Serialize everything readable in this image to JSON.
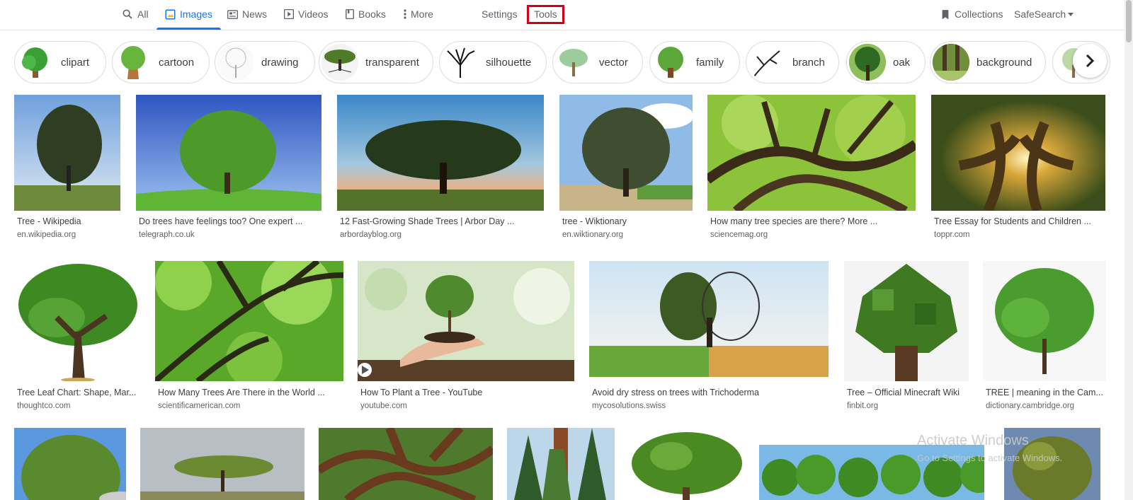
{
  "nav": {
    "all": "All",
    "images": "Images",
    "news": "News",
    "videos": "Videos",
    "books": "Books",
    "more": "More",
    "settings": "Settings",
    "tools": "Tools"
  },
  "right": {
    "collections": "Collections",
    "safesearch": "SafeSearch"
  },
  "chips": [
    "clipart",
    "cartoon",
    "drawing",
    "transparent",
    "silhouette",
    "vector",
    "family",
    "branch",
    "oak",
    "background"
  ],
  "results": [
    {
      "title": "Tree - Wikipedia",
      "source": "en.wikipedia.org"
    },
    {
      "title": "Do trees have feelings too? One expert ...",
      "source": "telegraph.co.uk"
    },
    {
      "title": "12 Fast-Growing Shade Trees | Arbor Day ...",
      "source": "arbordayblog.org"
    },
    {
      "title": "tree - Wiktionary",
      "source": "en.wiktionary.org"
    },
    {
      "title": "How many tree species are there? More ...",
      "source": "sciencemag.org"
    },
    {
      "title": "Tree Essay for Students and Children ...",
      "source": "toppr.com"
    },
    {
      "title": "Tree Leaf Chart: Shape, Mar...",
      "source": "thoughtco.com"
    },
    {
      "title": "How Many Trees Are There in the World ...",
      "source": "scientificamerican.com"
    },
    {
      "title": "How To Plant a Tree - YouTube",
      "source": "youtube.com"
    },
    {
      "title": "Avoid dry stress on trees with Trichoderma",
      "source": "mycosolutions.swiss"
    },
    {
      "title": "Tree – Official Minecraft Wiki",
      "source": "finbit.org"
    },
    {
      "title": "TREE | meaning in the Cam...",
      "source": "dictionary.cambridge.org"
    }
  ],
  "watermark": {
    "line1": "Activate Windows",
    "line2": "Go to Settings to activate Windows."
  }
}
